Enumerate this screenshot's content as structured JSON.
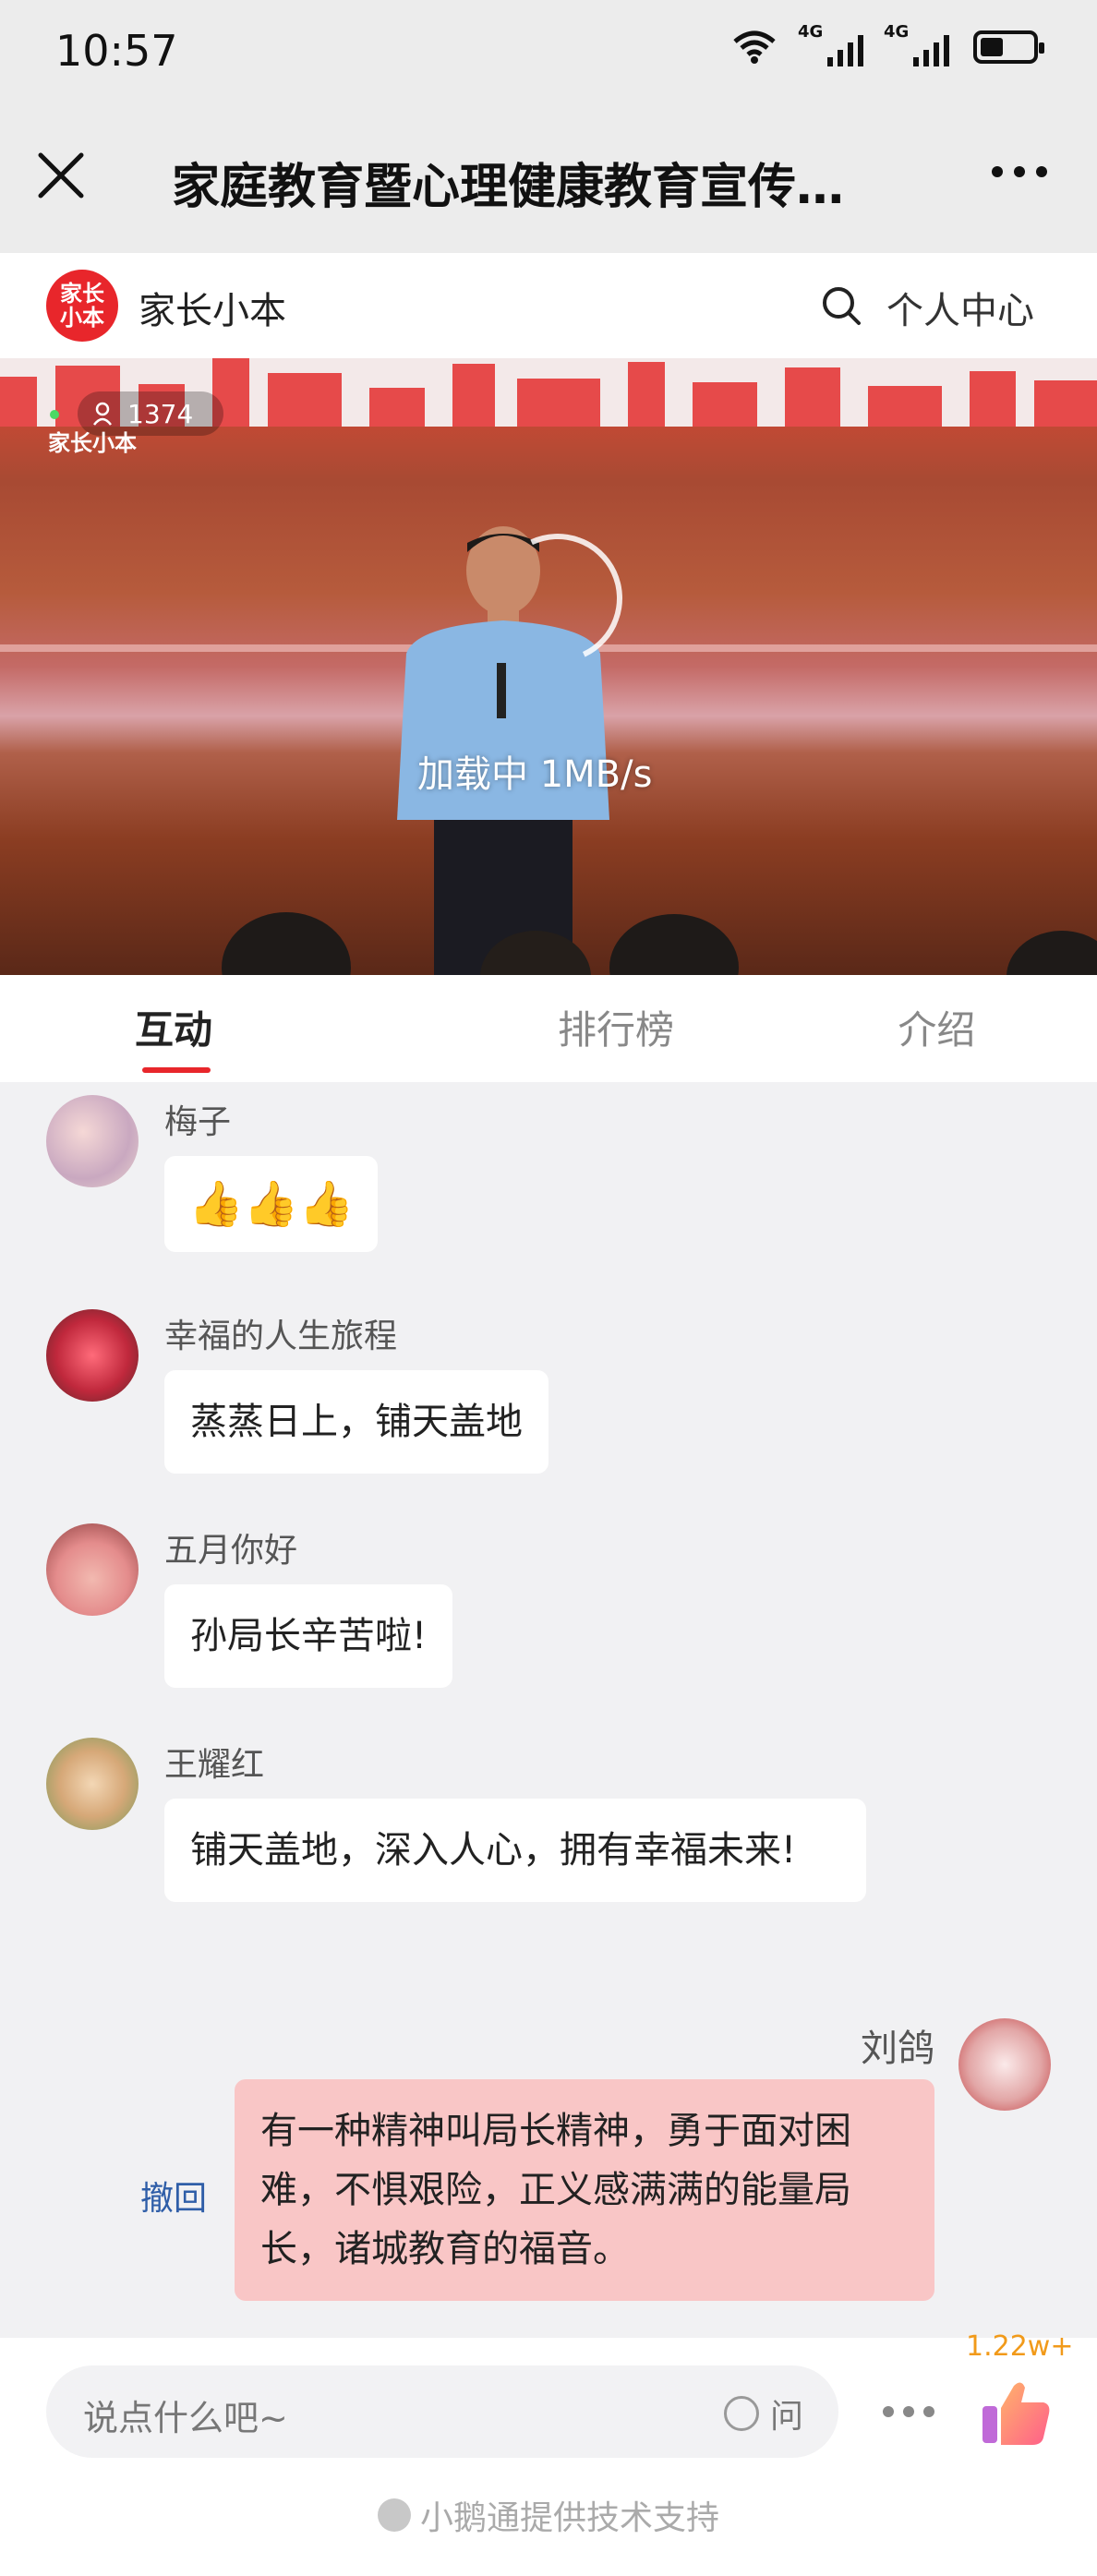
{
  "status_bar": {
    "time": "10:57",
    "net1": "4G",
    "net2": "4G"
  },
  "title_bar": {
    "title": "家庭教育暨心理健康教育宣传…"
  },
  "brand_bar": {
    "logo_text": "家长小本",
    "name": "家长小本",
    "user_center": "个人中心"
  },
  "video": {
    "viewer_count": "1374",
    "loading_text": "加载中 1MB/s",
    "watermark": "家长小本"
  },
  "tabs": [
    {
      "label": "互动"
    },
    {
      "label": "排行榜"
    },
    {
      "label": "介绍"
    }
  ],
  "messages": [
    {
      "user": "梅子",
      "text": "👍👍👍"
    },
    {
      "user": "幸福的人生旅程",
      "text": "蒸蒸日上，铺天盖地"
    },
    {
      "user": "五月你好",
      "text": "孙局长辛苦啦!"
    },
    {
      "user": "王耀红",
      "text": "铺天盖地，深入人心，拥有幸福未来!"
    },
    {
      "user": "刘鸽",
      "text": "有一种精神叫局长精神，勇于面对困难，不惧艰险，正义感满满的能量局长，诸城教育的福音。",
      "recall": "撤回"
    }
  ],
  "bottom_bar": {
    "input_placeholder": "说点什么吧~",
    "ask_label": "问",
    "like_count": "1.22w+",
    "support_text": "小鹅通提供技术支持"
  },
  "colors": {
    "accent": "#e8262b",
    "my_bubble": "#f9c6c6",
    "recall_link": "#2f5ea8"
  }
}
